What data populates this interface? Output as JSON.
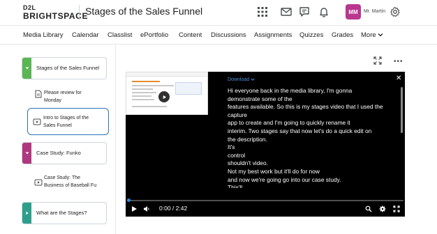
{
  "header": {
    "logo_top": "D2L",
    "logo_bottom": "BRIGHTSPACE",
    "course_title": "Stages of the Sales Funnel",
    "avatar_initials": "MM",
    "user_name": "Mr. Martin"
  },
  "nav": {
    "items": [
      "Media Library",
      "Calendar",
      "Classlist",
      "ePortfolio",
      "Content",
      "Discussions",
      "Assignments",
      "Quizzes",
      "Grades"
    ],
    "more_label": "More"
  },
  "sidebar": {
    "units": [
      {
        "label": "Stages of the Sales Funnel",
        "color": "#5ab553"
      },
      {
        "label": "Case Study: Funko",
        "color": "#b0377e"
      },
      {
        "label": "What are the Stages?",
        "color": "#2e9e8c"
      }
    ],
    "topics": [
      {
        "line1": "Please review for",
        "line2": "Monday"
      },
      {
        "line1": "Intro to Stages of the",
        "line2": "Sales Funnel"
      },
      {
        "line1": "Case Study: The",
        "line2": "Business of Baseball Fu"
      }
    ]
  },
  "player": {
    "download_label": "Download",
    "transcript_lines": [
      "Hi everyone back in the media library, I'm gonna",
      "demonstrate some of the",
      "features available. So this is my stages video that I used the",
      "capture",
      "app to create and I'm going to quickly rename it",
      "interim. Two stages say that now let's do a quick edit on",
      "the description.",
      "It's",
      "control",
      "shouldn't video.",
      "Not my best work but it'll do for now",
      "and now we're going go into our case study.",
      "This'll..."
    ],
    "time_current": "0:00",
    "time_total": "2:42",
    "time_display": "0:00 / 2:42",
    "progress_fraction": 0.0
  },
  "colors": {
    "accent": "#2a73b8",
    "avatar": "#b8378f",
    "player_bg": "#000000"
  }
}
